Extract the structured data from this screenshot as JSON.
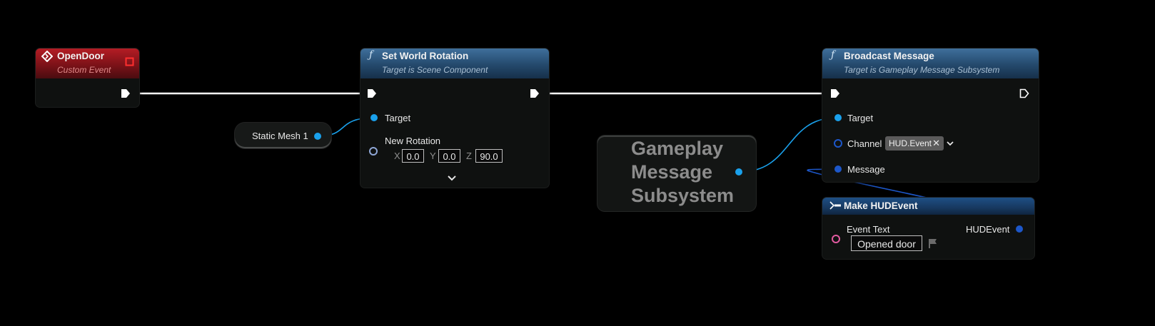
{
  "nodes": {
    "open_door": {
      "title": "OpenDoor",
      "subtitle": "Custom Event",
      "header_color": "#8d141b"
    },
    "static_mesh": {
      "label": "Static Mesh 1"
    },
    "set_world_rotation": {
      "title": "Set World Rotation",
      "subtitle": "Target is Scene Component",
      "target_label": "Target",
      "new_rotation_label": "New Rotation",
      "x_label": "X",
      "x_value": "0.0",
      "y_label": "Y",
      "y_value": "0.0",
      "z_label": "Z",
      "z_value": "90.0"
    },
    "gameplay_message_subsystem": {
      "line1": "Gameplay",
      "line2": "Message",
      "line3": "Subsystem"
    },
    "broadcast_message": {
      "title": "Broadcast Message",
      "subtitle": "Target is Gameplay Message Subsystem",
      "target_label": "Target",
      "channel_label": "Channel",
      "channel_value": "HUD.Event",
      "message_label": "Message"
    },
    "make_hud_event": {
      "title": "Make HUDEvent",
      "event_text_label": "Event Text",
      "event_text_value": "Opened door",
      "output_label": "HUDEvent"
    }
  },
  "colors": {
    "object_pin": "#1aa1ec",
    "struct_pin": "#1d57c9",
    "text_pin": "#e25aa0",
    "exec_wire": "#ffffff"
  },
  "icons": [
    "event-diamond-icon",
    "delegate-square-icon",
    "function-icon",
    "exec-pin-icon",
    "chevron-down-icon",
    "clear-x-icon",
    "flag-icon",
    "make-struct-icon"
  ]
}
